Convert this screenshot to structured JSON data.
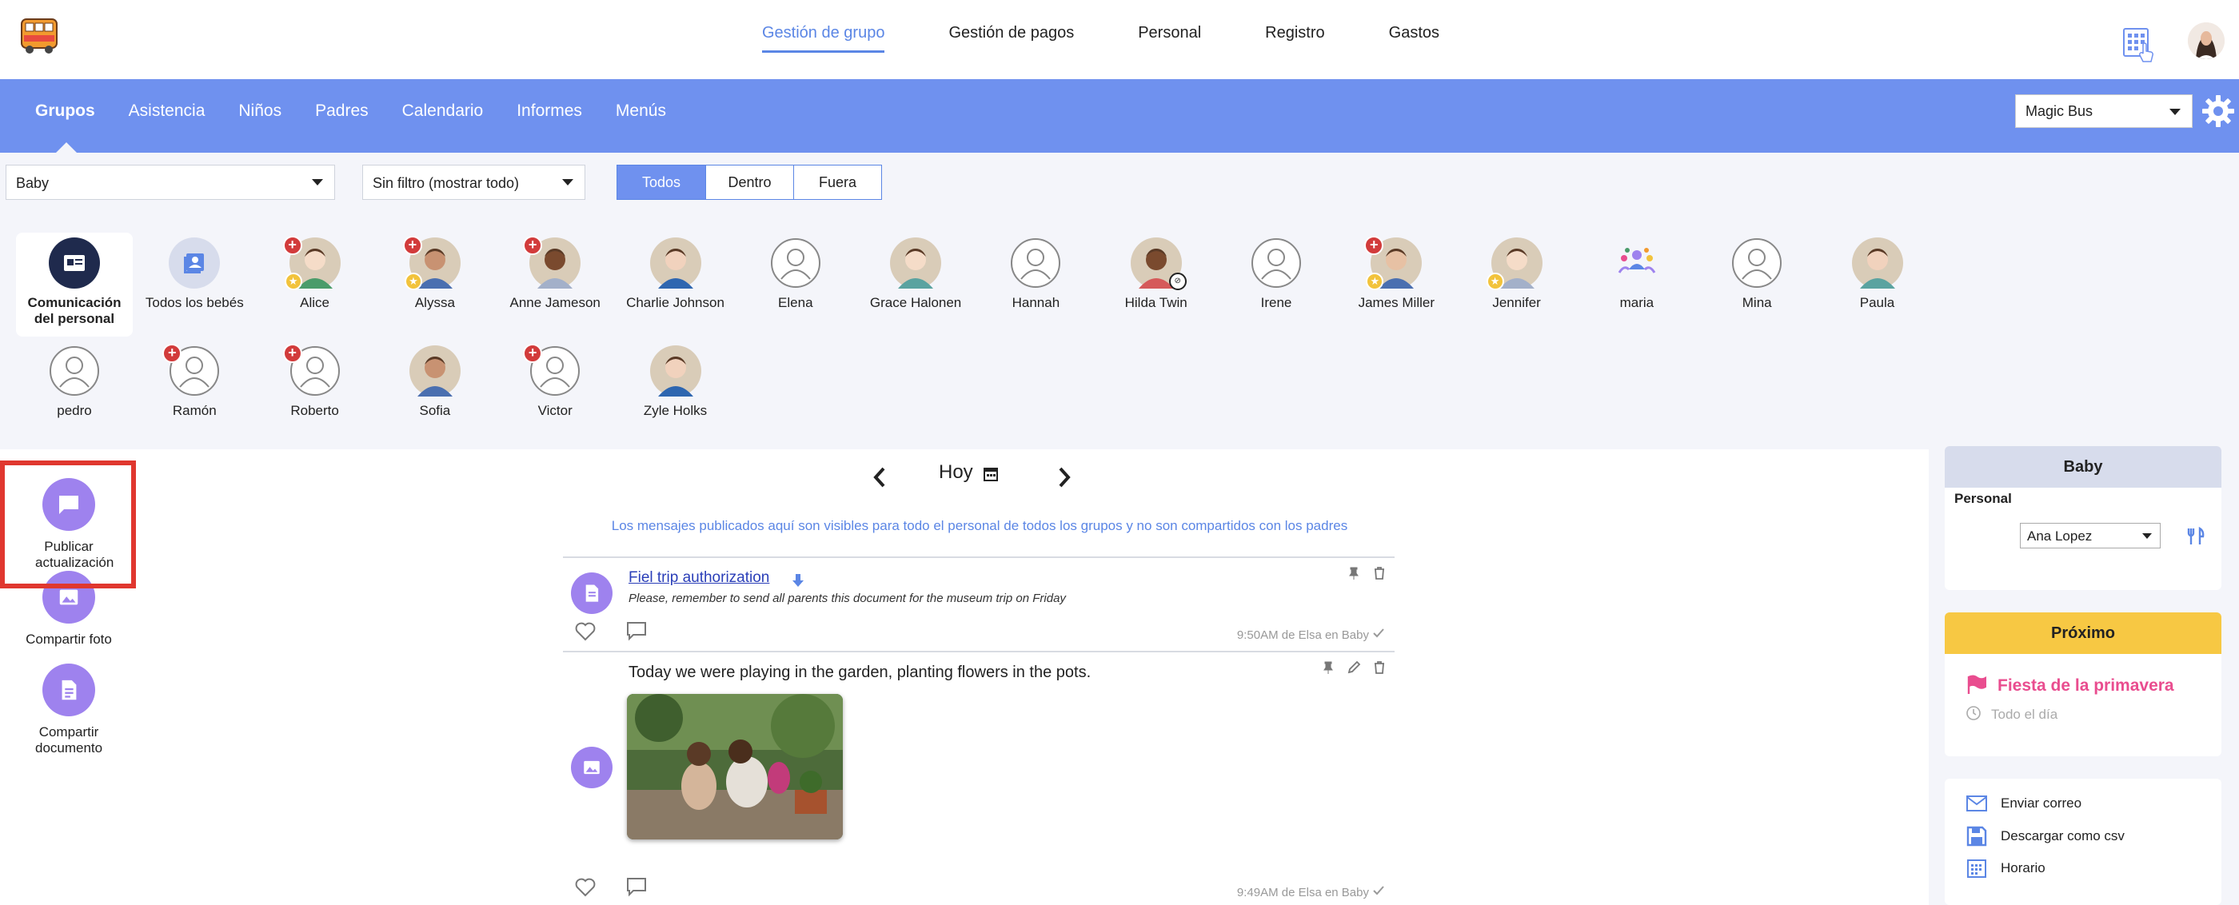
{
  "top_nav": {
    "items": [
      "Gestión de grupo",
      "Gestión de pagos",
      "Personal",
      "Registro",
      "Gastos"
    ],
    "active_index": 0
  },
  "sub_nav": {
    "items": [
      "Grupos",
      "Asistencia",
      "Niños",
      "Padres",
      "Calendario",
      "Informes",
      "Menús"
    ],
    "active_index": 0,
    "school_select": "Magic Bus"
  },
  "filters": {
    "group": "Baby",
    "filter": "Sin filtro (mostrar todo)",
    "segments": [
      "Todos",
      "Dentro",
      "Fuera"
    ],
    "active_segment": 0
  },
  "children_row1": [
    {
      "name": "Comunicación del personal",
      "kind": "staff",
      "badges": []
    },
    {
      "name": "Todos los bebés",
      "kind": "all",
      "badges": []
    },
    {
      "name": "Alice",
      "kind": "photo",
      "badges": [
        "plus",
        "star"
      ]
    },
    {
      "name": "Alyssa",
      "kind": "photo",
      "badges": [
        "plus",
        "star"
      ]
    },
    {
      "name": "Anne Jameson",
      "kind": "photo",
      "badges": [
        "plus"
      ]
    },
    {
      "name": "Charlie Johnson",
      "kind": "photo",
      "badges": []
    },
    {
      "name": "Elena",
      "kind": "default",
      "badges": []
    },
    {
      "name": "Grace Halonen",
      "kind": "photo",
      "badges": []
    },
    {
      "name": "Hannah",
      "kind": "default",
      "badges": []
    },
    {
      "name": "Hilda Twin",
      "kind": "photo",
      "badges": [
        "camera"
      ]
    },
    {
      "name": "Irene",
      "kind": "default",
      "badges": []
    },
    {
      "name": "James Miller",
      "kind": "photo",
      "badges": [
        "plus",
        "star"
      ]
    },
    {
      "name": "Jennifer",
      "kind": "photo",
      "badges": [
        "star"
      ]
    },
    {
      "name": "maria",
      "kind": "logo",
      "badges": []
    },
    {
      "name": "Mina",
      "kind": "default",
      "badges": []
    },
    {
      "name": "Paula",
      "kind": "photo",
      "badges": []
    }
  ],
  "children_row2": [
    {
      "name": "pedro",
      "kind": "default",
      "badges": []
    },
    {
      "name": "Ramón",
      "kind": "default",
      "badges": [
        "plus"
      ]
    },
    {
      "name": "Roberto",
      "kind": "default",
      "badges": [
        "plus"
      ]
    },
    {
      "name": "Sofia",
      "kind": "photo",
      "badges": []
    },
    {
      "name": "Victor",
      "kind": "default",
      "badges": [
        "plus"
      ]
    },
    {
      "name": "Zyle Holks",
      "kind": "photo",
      "badges": []
    }
  ],
  "actions": {
    "publish": "Publicar actualización",
    "share_photo": "Compartir foto",
    "share_doc": "Compartir documento"
  },
  "feed": {
    "date_label": "Hoy",
    "info": "Los mensajes publicados aquí son visibles para todo el personal de todos los grupos y no son compartidos con los padres",
    "post1": {
      "title": "Fiel trip authorization",
      "desc": "Please, remember to send all parents this document for the museum trip on Friday",
      "meta": "9:50AM de Elsa en Baby"
    },
    "post2": {
      "text": "Today we were playing in the garden, planting flowers in the pots.",
      "meta": "9:49AM de Elsa en Baby"
    }
  },
  "right": {
    "group_title": "Baby",
    "staff_label": "Personal",
    "staff_select": "Ana Lopez",
    "next_title": "Próximo",
    "event_name": "Fiesta de la primavera",
    "event_time": "Todo el día",
    "links": [
      "Enviar correo",
      "Descargar como csv",
      "Horario"
    ]
  },
  "colors": {
    "accent": "#6f91ef",
    "link": "#5b86e5",
    "purple": "#9e82ee",
    "highlight": "#e0372f",
    "next_header": "#f7c843",
    "event_pink": "#e94d8f"
  }
}
